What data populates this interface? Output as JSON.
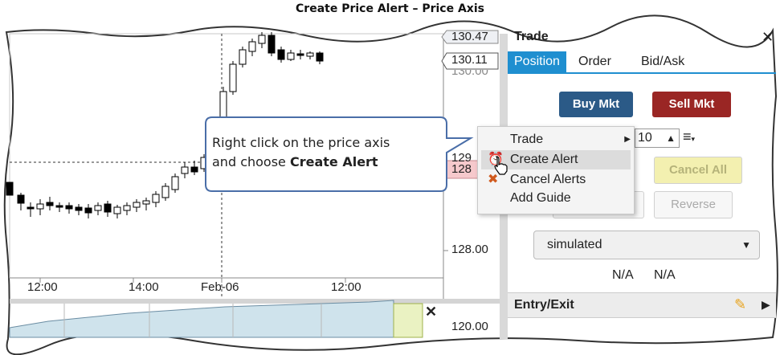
{
  "title": "Create Price Alert – Price Axis",
  "price_axis": {
    "tag_top": "130.47",
    "tag_second": "130.11",
    "partial_under_tag": "130.00",
    "label_128": "128.00",
    "tag_current_partial": "128",
    "partial_129": "129",
    "lower_axis_label": "120.00"
  },
  "time_axis": [
    "12:00",
    "14:00",
    "Feb-06",
    "12:00"
  ],
  "callout": {
    "line1": "Right click on the price axis",
    "line2_prefix": "and choose ",
    "line2_bold": "Create Alert"
  },
  "context_menu": {
    "items": [
      {
        "label": "Trade",
        "icon": "",
        "has_submenu": true
      },
      {
        "label": "Create Alert",
        "icon": "alarm-clock-icon",
        "highlighted": true
      },
      {
        "label": "Cancel Alerts",
        "icon": "alarm-cancel-icon"
      },
      {
        "label": "Add Guide",
        "icon": ""
      }
    ]
  },
  "trade_panel": {
    "title": "Trade",
    "tabs": [
      "Position",
      "Order",
      "Bid/Ask"
    ],
    "active_tab": "Position",
    "buy_label": "Buy Mkt",
    "sell_label": "Sell Mkt",
    "quantity": "10",
    "cancel_all_label": "Cancel All",
    "reverse_label": "Reverse",
    "account_select": "simulated",
    "status_values": [
      "N/A",
      "N/A"
    ],
    "entry_exit_title": "Entry/Exit"
  },
  "colors": {
    "buy": "#2b5a87",
    "sell": "#9a2624",
    "active_tab": "#1f8fd0",
    "cancel_all_bg": "#f3f0b0",
    "alert_tag": "#f6c9cc",
    "callout_border": "#4a6ea8",
    "lower_fill": "#cfe3ec"
  }
}
